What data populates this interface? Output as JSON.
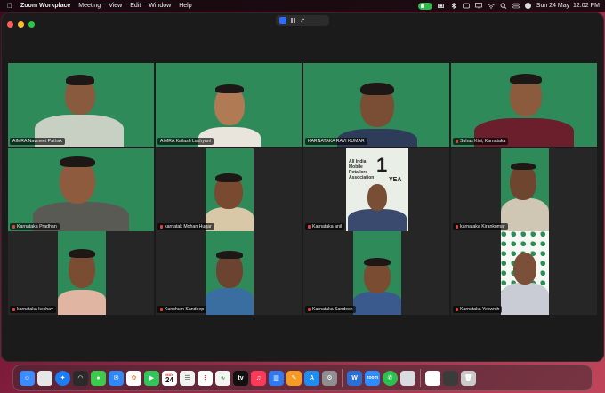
{
  "menubar": {
    "app_name": "Zoom Workplace",
    "menus": [
      "Meeting",
      "View",
      "Edit",
      "Window",
      "Help"
    ],
    "datetime": "Sun 24 May  12:02 PM"
  },
  "participants": [
    "AIMRA Navmeet Pathak",
    "AIMRA Kailash Lakhyani",
    "KARNATAKA RAVI KUMAR",
    "Suhas Kini, Karnataka",
    "Karnataka Pradhan",
    "karnatak Mohan Hugar",
    "Karnataka anil",
    "karnataka Kirankumar",
    "karnataka keshav",
    "Kunchum Sandeep",
    "Karnataka Sandesh",
    "Karnataka Yeswnth"
  ],
  "banner": {
    "text": "All India Mobile Retailers Association",
    "number": "1",
    "years": "YEA"
  },
  "calendar": {
    "month": "MAY",
    "day": "24"
  },
  "colors": {
    "wallpaper": "#8a2040",
    "zoom_bg": "#1b1b1b",
    "backdrop_green": "#2f8a5a",
    "muted_mic": "#e2403a",
    "recording": "#2fb84b"
  }
}
